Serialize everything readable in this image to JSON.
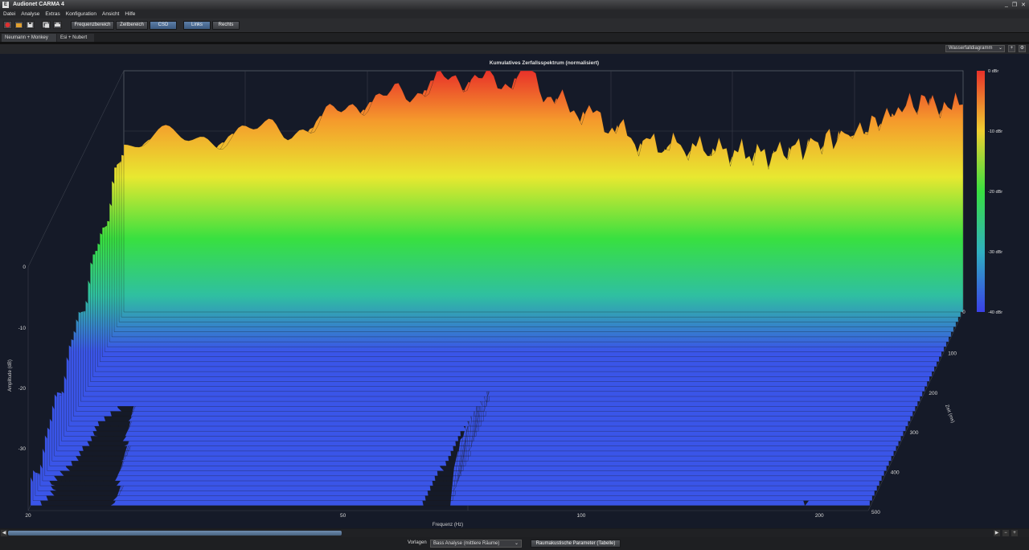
{
  "window": {
    "title": "Audionet CARMA 4",
    "icon": "E",
    "buttons": [
      "_",
      "❐",
      "✕"
    ]
  },
  "menu": [
    "Datei",
    "Analyse",
    "Extras",
    "Konfiguration",
    "Ansicht",
    "Hilfe"
  ],
  "toolbar": {
    "icons": [
      "record-icon",
      "open-icon",
      "save-icon",
      "copy-icon",
      "print-icon"
    ],
    "view_buttons": [
      "Frequenzbereich",
      "Zeitbereich",
      "CSD"
    ],
    "channel_buttons": [
      "Links",
      "Rechts"
    ],
    "active_view": "CSD",
    "active_channel": "Links"
  },
  "tabs": [
    {
      "label": "Neumann + Monkey",
      "close": "✕",
      "active": true
    },
    {
      "label": "Esi + Nubert",
      "active": false
    }
  ],
  "view_select": {
    "value": "Wasserfalldiagramm",
    "arrow": "⌄"
  },
  "view_buttons_small": [
    "+",
    "⚙"
  ],
  "chart_data": {
    "type": "waterfall",
    "title": "Kumulatives Zerfallsspektrum (normalisiert)",
    "xlabel": "Frequenz (Hz)",
    "ylabel": "Amplitude (dB)",
    "zlabel": "Zeit (ms)",
    "x_ticks": [
      "20",
      "50",
      "100",
      "200"
    ],
    "y_ticks": [
      "0",
      "-10",
      "-20",
      "-30"
    ],
    "z_ticks": [
      "100",
      "200",
      "300",
      "400",
      "500"
    ],
    "colorbar_ticks": [
      "0 dBr",
      "-10 dBr",
      "-20 dBr",
      "-30 dBr",
      "-40 dBr"
    ],
    "colorbar_zero": "0",
    "colors": [
      "#e8302a",
      "#f59a2c",
      "#e8e830",
      "#38e040",
      "#2fc0a0",
      "#3a55e8"
    ],
    "grid": true,
    "frequency_profile": [
      {
        "hz": 20,
        "db": -12
      },
      {
        "hz": 25,
        "db": -11
      },
      {
        "hz": 30,
        "db": -10
      },
      {
        "hz": 35,
        "db": -9
      },
      {
        "hz": 40,
        "db": -5
      },
      {
        "hz": 45,
        "db": -4
      },
      {
        "hz": 50,
        "db": -2
      },
      {
        "hz": 55,
        "db": -1
      },
      {
        "hz": 60,
        "db": -2
      },
      {
        "hz": 65,
        "db": 0
      },
      {
        "hz": 70,
        "db": -5
      },
      {
        "hz": 80,
        "db": -8
      },
      {
        "hz": 90,
        "db": -12
      },
      {
        "hz": 110,
        "db": -13
      },
      {
        "hz": 130,
        "db": -14
      },
      {
        "hz": 150,
        "db": -12
      },
      {
        "hz": 170,
        "db": -10
      },
      {
        "hz": 200,
        "db": -5
      },
      {
        "hz": 230,
        "db": -6
      }
    ]
  },
  "scrollbar": {
    "left": "◀",
    "right": "▶",
    "zoom_out": "−",
    "zoom_in": "+"
  },
  "statusbar": {
    "vorlagen_label": "Vorlagen",
    "template_select": "Bass Analyse (mittlere Räume)",
    "template_arrow": "⌄",
    "params_button": "Raumakustische Parameter (Tabelle)"
  }
}
